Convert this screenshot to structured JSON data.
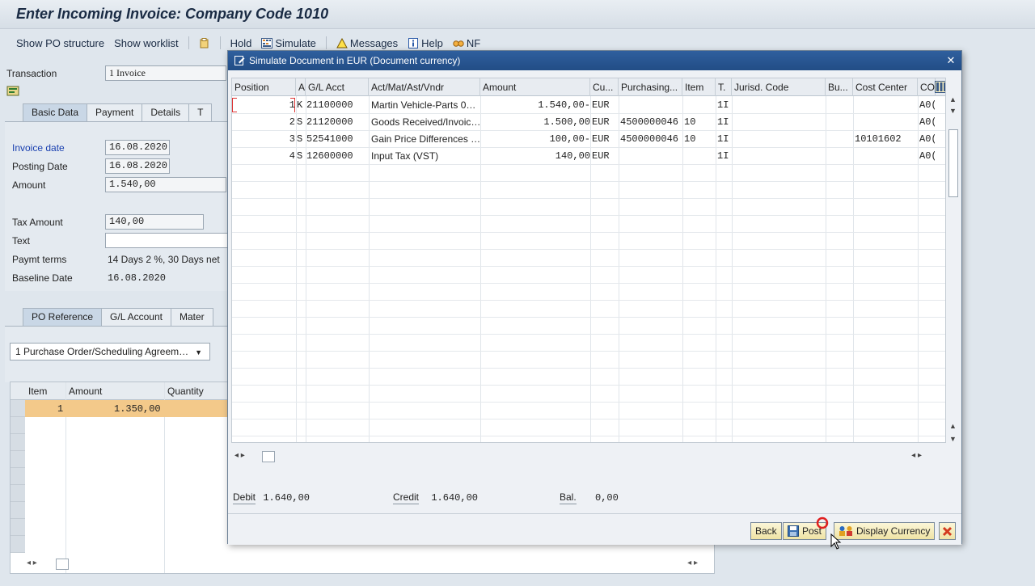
{
  "header": {
    "title": "Enter Incoming Invoice: Company Code 1010"
  },
  "toolbar": {
    "show_po_structure": "Show PO structure",
    "show_worklist": "Show worklist",
    "hold": "Hold",
    "simulate": "Simulate",
    "messages": "Messages",
    "help": "Help",
    "nf": "NF"
  },
  "form": {
    "transaction_label": "Transaction",
    "transaction_value": "1 Invoice",
    "tabs": [
      "Basic Data",
      "Payment",
      "Details",
      "T"
    ],
    "invoice_date_label": "Invoice date",
    "invoice_date": "16.08.2020",
    "posting_date_label": "Posting Date",
    "posting_date": "16.08.2020",
    "amount_label": "Amount",
    "amount": "1.540,00",
    "tax_amount_label": "Tax Amount",
    "tax_amount": "140,00",
    "text_label": "Text",
    "text": "",
    "payment_terms_label": "Paymt terms",
    "payment_terms": "14 Days 2 %, 30 Days net",
    "baseline_date_label": "Baseline Date",
    "baseline_date": "16.08.2020",
    "ref_tabs": [
      "PO Reference",
      "G/L Account",
      "Mater"
    ],
    "reference_type": "1 Purchase Order/Scheduling Agreem…"
  },
  "po_grid": {
    "columns": [
      "Item",
      "Amount",
      "Quantity"
    ],
    "rows": [
      {
        "item": "1",
        "amount": "1.350,00",
        "quantity": ""
      }
    ]
  },
  "dialog": {
    "title": "Simulate Document in EUR (Document currency)",
    "columns": [
      "Position",
      "A",
      "G/L Acct",
      "Act/Mat/Ast/Vndr",
      "Amount",
      "Cu...",
      "Purchasing...",
      "Item",
      "T.",
      "Jurisd. Code",
      "Bu...",
      "Cost Center",
      "CO"
    ],
    "rows": [
      {
        "pos": "1",
        "a": "K",
        "gl": "21100000",
        "name": "Martin Vehicle-Parts 0…",
        "amount": "1.540,00-",
        "cur": "EUR",
        "po": "",
        "item": "",
        "tax": "1I",
        "cost_center": "",
        "co": "A0("
      },
      {
        "pos": "2",
        "a": "S",
        "gl": "21120000",
        "name": "Goods Received/Invoic…",
        "amount": "1.500,00",
        "cur": "EUR",
        "po": "4500000046",
        "item": "10",
        "tax": "1I",
        "cost_center": "",
        "co": "A0("
      },
      {
        "pos": "3",
        "a": "S",
        "gl": "52541000",
        "name": "Gain Price Differences …",
        "amount": "100,00-",
        "cur": "EUR",
        "po": "4500000046",
        "item": "10",
        "tax": "1I",
        "cost_center": "10101602",
        "co": "A0("
      },
      {
        "pos": "4",
        "a": "S",
        "gl": "12600000",
        "name": "Input Tax (VST)",
        "amount": "140,00",
        "cur": "EUR",
        "po": "",
        "item": "",
        "tax": "1I",
        "cost_center": "",
        "co": "A0("
      }
    ],
    "debit_label": "Debit",
    "debit": "1.640,00",
    "credit_label": "Credit",
    "credit": "1.640,00",
    "balance_label": "Bal.",
    "balance": "0,00",
    "buttons": {
      "back": "Back",
      "post": "Post",
      "display_currency": "Display Currency"
    }
  },
  "colors": {
    "title_blue": "#224d86",
    "selected_row": "#f3c98a",
    "button_yellow": "#efe3a4",
    "cancel_red": "#d33a1f"
  }
}
